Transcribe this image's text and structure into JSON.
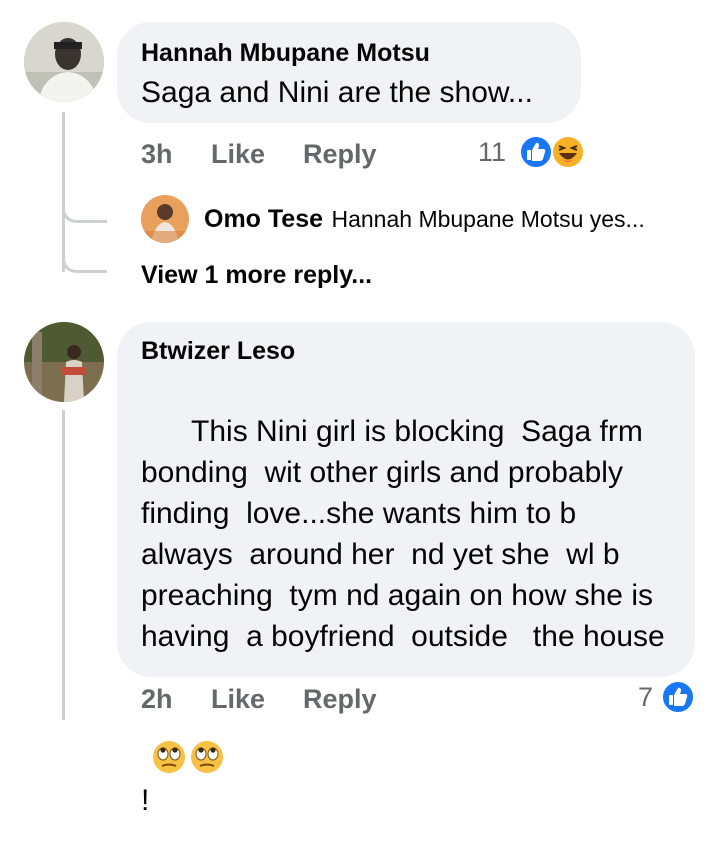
{
  "comments": [
    {
      "author": "Hannah Mbupane Motsu",
      "text": "Saga and Nini are the show...",
      "time": "3h",
      "like_label": "Like",
      "reply_label": "Reply",
      "reaction_count": "11",
      "reactions": [
        "like-icon",
        "haha-icon"
      ],
      "replies": [
        {
          "author": "Omo Tese",
          "preview": "Hannah Mbupane Motsu yes..."
        }
      ],
      "view_more_label": "View 1 more reply..."
    },
    {
      "author": "Btwizer Leso",
      "text": "This Nini girl is blocking  Saga frm bonding  wit other girls and probably finding  love...she wants him to b always  around her  nd yet she  wl b preaching  tym nd again on how she is having  a boyfriend  outside   the house !",
      "emojis": [
        "eye-roll-emoji",
        "eye-roll-emoji"
      ],
      "time": "2h",
      "like_label": "Like",
      "reply_label": "Reply",
      "reaction_count": "7",
      "reactions": [
        "like-icon"
      ]
    }
  ],
  "colors": {
    "bubble": "#f0f2f5",
    "secondary_text": "#65676b",
    "like_blue": "#1877f2",
    "haha_yellow": "#f7b125",
    "thread_line": "#ced0d4"
  }
}
